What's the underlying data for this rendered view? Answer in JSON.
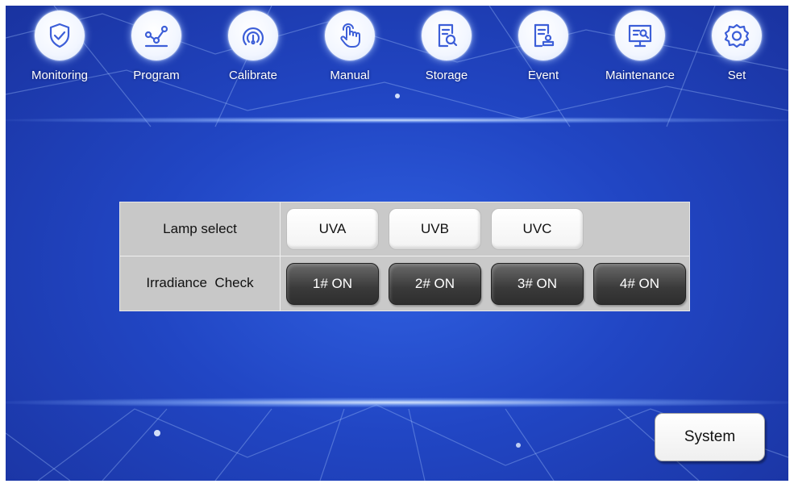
{
  "nav": [
    {
      "label": "Monitoring",
      "icon": "shield-check-icon"
    },
    {
      "label": "Program",
      "icon": "graph-nodes-icon"
    },
    {
      "label": "Calibrate",
      "icon": "gauge-icon"
    },
    {
      "label": "Manual",
      "icon": "hand-pointer-icon"
    },
    {
      "label": "Storage",
      "icon": "document-search-icon"
    },
    {
      "label": "Event",
      "icon": "document-stamp-icon"
    },
    {
      "label": "Maintenance",
      "icon": "screen-wrench-icon"
    },
    {
      "label": "Set",
      "icon": "gear-icon"
    }
  ],
  "panel": {
    "lamp_select_label": "Lamp select",
    "lamps": [
      "UVA",
      "UVB",
      "UVC"
    ],
    "irradiance_label": "Irradiance  Check",
    "checks": [
      "1# ON",
      "2# ON",
      "3# ON",
      "4# ON"
    ]
  },
  "system_button": "System",
  "colors": {
    "background": "#2146c4",
    "icon_stroke": "#3d5fd8",
    "dark_button": "#3a3a3a",
    "panel": "#c9c9c9"
  }
}
